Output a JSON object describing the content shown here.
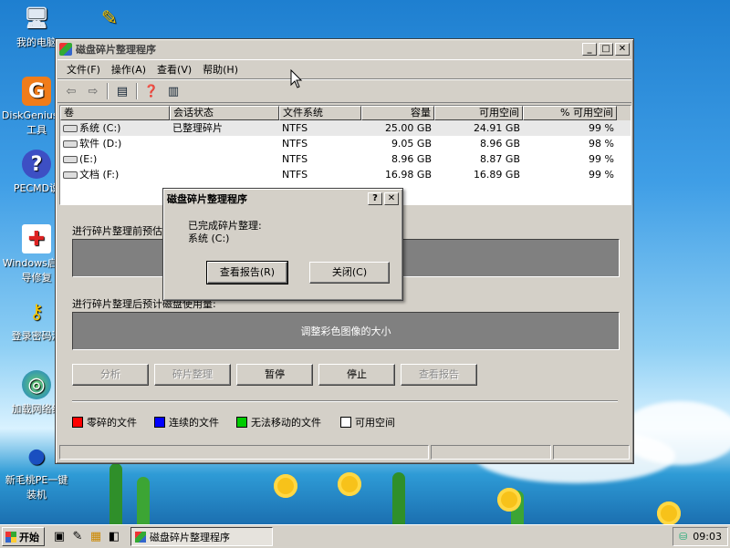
{
  "desktop": {
    "icons": [
      {
        "label": "我的电脑",
        "icon": "computer-icon"
      },
      {
        "label": "DiskGenius 区工具",
        "icon": "diskgenius-icon"
      },
      {
        "label": "PECMD说",
        "icon": "help-icon"
      },
      {
        "label": "Windows启 引导修复",
        "icon": "repair-icon"
      },
      {
        "label": "登录密码清",
        "icon": "key-icon"
      },
      {
        "label": "加载网络组",
        "icon": "network-icon"
      },
      {
        "label": "新毛桃PE一键 装机",
        "icon": "peach-icon"
      }
    ]
  },
  "window": {
    "title": "磁盘碎片整理程序",
    "menu": [
      "文件(F)",
      "操作(A)",
      "查看(V)",
      "帮助(H)"
    ],
    "columns": [
      "卷",
      "会话状态",
      "文件系统",
      "容量",
      "可用空间",
      "% 可用空间"
    ],
    "rows": [
      {
        "vol": "系统 (C:)",
        "status": "已整理碎片",
        "fs": "NTFS",
        "cap": "25.00 GB",
        "free": "24.91 GB",
        "pct": "99 %"
      },
      {
        "vol": "软件 (D:)",
        "status": "",
        "fs": "NTFS",
        "cap": "9.05 GB",
        "free": "8.96 GB",
        "pct": "98 %"
      },
      {
        "vol": "(E:)",
        "status": "",
        "fs": "NTFS",
        "cap": "8.96 GB",
        "free": "8.87 GB",
        "pct": "99 %"
      },
      {
        "vol": "文档 (F:)",
        "status": "",
        "fs": "NTFS",
        "cap": "16.98 GB",
        "free": "16.89 GB",
        "pct": "99 %"
      }
    ],
    "before_label": "进行碎片整理前预估",
    "after_label": "进行碎片整理后预计磁盘使用量:",
    "resize_hint": "调整彩色图像的大小",
    "buttons": {
      "analyze": "分析",
      "defrag": "碎片整理",
      "pause": "暂停",
      "stop": "停止",
      "report": "查看报告"
    },
    "legend": [
      {
        "label": "零碎的文件",
        "color": "#ff0000"
      },
      {
        "label": "连续的文件",
        "color": "#0000ff"
      },
      {
        "label": "无法移动的文件",
        "color": "#00cc00"
      },
      {
        "label": "可用空间",
        "color": "#ffffff"
      }
    ]
  },
  "dialog": {
    "title": "磁盘碎片整理程序",
    "line1": "已完成碎片整理:",
    "line2": "系统 (C:)",
    "view_report": "查看报告(R)",
    "close": "关闭(C)"
  },
  "taskbar": {
    "start": "开始",
    "task_title": "磁盘碎片整理程序",
    "clock": "09:03"
  }
}
